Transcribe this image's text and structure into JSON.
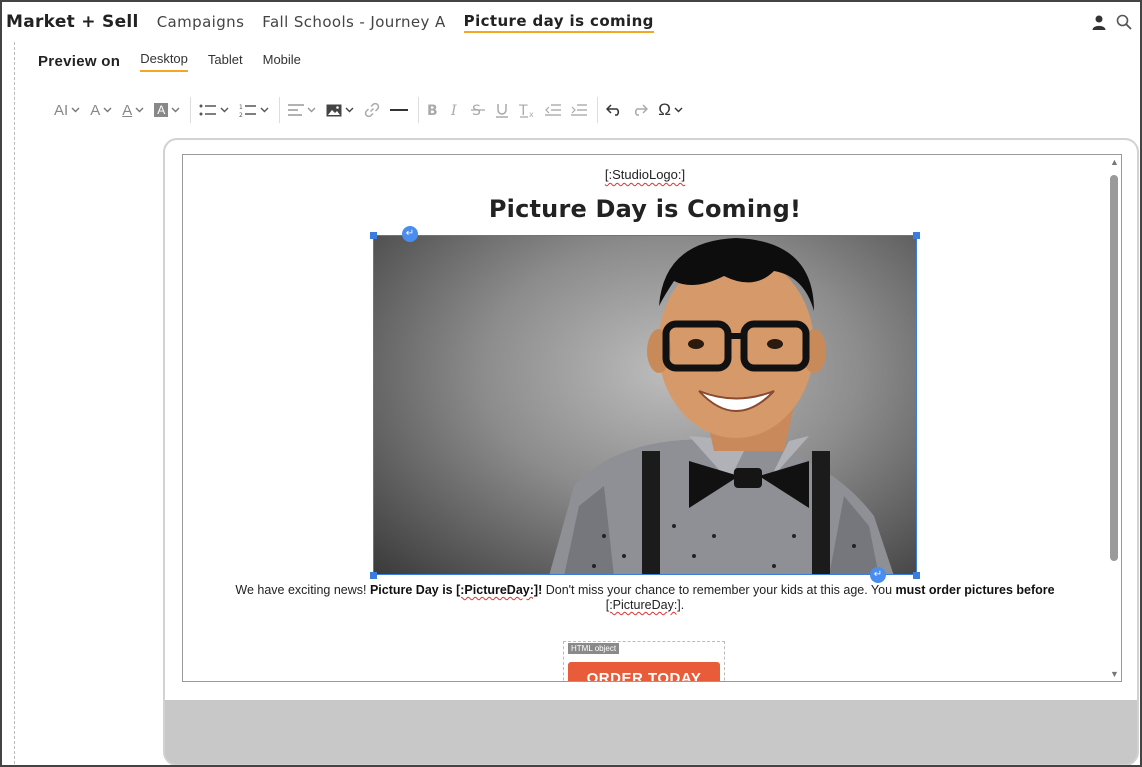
{
  "header": {
    "brand": "Market + Sell",
    "breadcrumbs": [
      "Campaigns",
      "Fall Schools - Journey A",
      "Picture day is coming"
    ],
    "icons": [
      "user-icon",
      "search-icon"
    ]
  },
  "preview": {
    "label": "Preview on",
    "tabs": [
      "Desktop",
      "Tablet",
      "Mobile"
    ],
    "active_tab": "Desktop"
  },
  "toolbar": {
    "font_size_label": "AI",
    "font_style_label": "A",
    "font_color_label": "A",
    "bg_color_label": "A",
    "special_char_label": "Ω",
    "icons": [
      "font-size-icon",
      "font-style-icon",
      "font-color-icon",
      "background-color-icon",
      "bullet-list-icon",
      "numbered-list-icon",
      "align-icon",
      "image-icon",
      "link-icon",
      "horizontal-rule-icon",
      "bold-icon",
      "italic-icon",
      "strikethrough-icon",
      "underline-icon",
      "clear-format-icon",
      "outdent-icon",
      "indent-icon",
      "undo-icon",
      "redo-icon",
      "special-character-icon"
    ]
  },
  "email": {
    "logo_placeholder": "[:StudioLogo:]",
    "headline": "Picture Day is Coming!",
    "body": {
      "intro": "We have exciting news! ",
      "bold_a": "Picture Day is ",
      "token_a": "[:PictureDay:]",
      "bold_a_end": "!",
      "middle": " Don't miss your chance to remember your kids at this age. You ",
      "bold_b": "must order pictures before",
      "token_b": "[:PictureDay:]",
      "end": "."
    },
    "html_object_label": "HTML object",
    "cta_label": "ORDER TODAY"
  },
  "colors": {
    "accent_underline": "#f5a623",
    "selection_blue": "#3b7ddd",
    "cta": "#e85c3a"
  }
}
